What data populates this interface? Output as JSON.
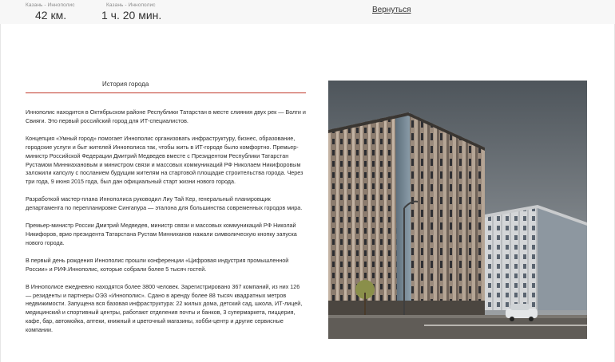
{
  "header": {
    "distance": {
      "label": "Казань - Иннополис",
      "value": "42 км."
    },
    "duration": {
      "label": "Казань - Иннополис",
      "value": "1 ч. 20 мин."
    },
    "back_link": "Вернуться"
  },
  "article": {
    "title": "История города",
    "paragraphs": [
      "Иннополис находится в Октябрьском районе Республики Татарстан в месте слияния двух рек — Волги и Свияги. Это первый российский город для ИТ-специалистов.",
      "Концепция «Умный город» помогает Иннополис организовать инфраструктуру, бизнес, образование, городские услуги и быт жителей Иннополиса так, чтобы жить в ИТ-городе было комфортно. Премьер-министр Российской Федерации Дмитрий Медведев вместе с Президентом Республики Татарстан Рустамом Минниахановым и министром связи и массовых коммуникаций РФ Николаем Никифоровым заложили капсулу с посланием будущим жителям на стартовой площадке строительства города. Через три года, 9 июня 2015 года, был дан официальный старт жизни нового города.",
      "Разработкой мастер-плана Иннополиса руководил Лиу Тай Кер, генеральный планировщик департамента по перепланировке Сингапура — эталона для большинства современных городов мира.",
      "Премьер-министр России Дмитрий Медведев, министр связи и массовых коммуникаций РФ Николай Никифоров, врио президента Татарстана Рустам Минниханов нажали символическую кнопку запуска нового города.",
      "В первый день рождения Иннополис прошли конференции «Цифровая индустрия промышленной России» и РИФ.Иннополис, которые собрали более 5 тысяч гостей.",
      "В Иннополисе ежедневно находятся более 3800 человек. Зарегистрировано 367 компаний, из них 126 — резиденты и партнеры ОЭЗ «Иннополис». Сдано в аренду более 88 тысяч квадратных метров недвижимости. Запущена вся базовая инфраструктура: 22 жилых дома, детский сад, школа, ИТ-лицей, медицинский и спортивный центры, работают отделения почты и банков, 3 супермаркета, пиццерия, кафе, бар, автомойка, аптеки, книжный и цветочный магазины, хобби-центр и другие сервисные компании."
    ]
  },
  "colors": {
    "accent_rule": "#c0392b",
    "top_strip": "#f7f7f7"
  }
}
